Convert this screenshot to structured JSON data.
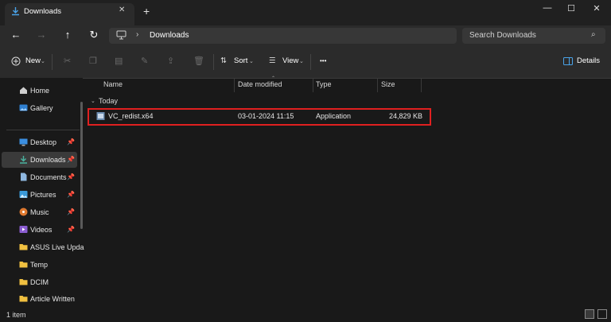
{
  "window": {
    "tab_title": "Downloads",
    "new_tab": "+",
    "close_tab": "✕",
    "minimize": "—",
    "maximize": "☐",
    "close": "✕"
  },
  "nav": {
    "back": "←",
    "forward": "→",
    "up": "↑",
    "refresh": "↻",
    "breadcrumb_sep": "›",
    "location": "Downloads",
    "search_placeholder": "Search Downloads",
    "search_icon": "⌕"
  },
  "toolbar": {
    "new_label": "New",
    "sort_label": "Sort",
    "view_label": "View",
    "more_label": "•••",
    "details_label": "Details",
    "icons": [
      "cut-icon",
      "copy-icon",
      "paste-icon",
      "rename-icon",
      "share-icon",
      "delete-icon"
    ]
  },
  "sidebar": {
    "items": [
      {
        "label": "Home",
        "icon": "home-icon",
        "pinned": false
      },
      {
        "label": "Gallery",
        "icon": "gallery-icon",
        "pinned": false
      },
      {
        "label": "Desktop",
        "icon": "desktop-icon",
        "pinned": true
      },
      {
        "label": "Downloads",
        "icon": "download-icon",
        "pinned": true,
        "active": true
      },
      {
        "label": "Documents",
        "icon": "documents-icon",
        "pinned": true
      },
      {
        "label": "Pictures",
        "icon": "pictures-icon",
        "pinned": true
      },
      {
        "label": "Music",
        "icon": "music-icon",
        "pinned": true
      },
      {
        "label": "Videos",
        "icon": "videos-icon",
        "pinned": true
      },
      {
        "label": "ASUS Live Upda",
        "icon": "folder-icon",
        "pinned": false
      },
      {
        "label": "Temp",
        "icon": "folder-icon",
        "pinned": false
      },
      {
        "label": "DCIM",
        "icon": "folder-icon",
        "pinned": false
      },
      {
        "label": "Article Written",
        "icon": "folder-icon",
        "pinned": false
      }
    ]
  },
  "columns": [
    "Name",
    "Date modified",
    "Type",
    "Size"
  ],
  "group_label": "Today",
  "files": [
    {
      "name": "VC_redist.x64",
      "date": "03-01-2024 11:15",
      "type": "Application",
      "size": "24,829 KB"
    }
  ],
  "status": {
    "count": "1 item"
  },
  "colors": {
    "highlight": "#e02020",
    "folder": "#f0c040"
  }
}
